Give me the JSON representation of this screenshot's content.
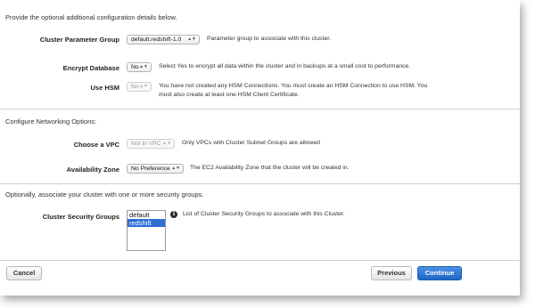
{
  "intro_text": "Provide the optional additional configuration details below.",
  "cluster_parameter_group": {
    "label": "Cluster Parameter Group",
    "value": "default.redshift-1.0",
    "help": "Parameter group to associate with this cluster."
  },
  "encrypt_database": {
    "label": "Encrypt Database",
    "value": "No",
    "help": "Select Yes to encrypt all data within the cluster and in backups at a small cost to performance."
  },
  "use_hsm": {
    "label": "Use HSM",
    "value": "No",
    "help_line1": "You have not created any HSM Connections. You must create an HSM Connection to use HSM. You",
    "help_line2": "must also create at least one HSM Client Certificate."
  },
  "networking_text": "Configure Networking Options:",
  "choose_vpc": {
    "label": "Choose a VPC",
    "value": "Not in VPC",
    "help": "Only VPCs with Cluster Subnet Groups are allowed"
  },
  "availability_zone": {
    "label": "Availability Zone",
    "value": "No Preference",
    "help": "The EC2 Availability Zone that the cluster will be created in."
  },
  "security_text": "Optionally, associate your cluster with one or more security groups.",
  "cluster_security_groups": {
    "label": "Cluster Security Groups",
    "options": [
      "default",
      "redshift"
    ],
    "selected": "redshift",
    "help": "List of Cluster Security Groups to associate with this Cluster."
  },
  "buttons": {
    "cancel": "Cancel",
    "previous": "Previous",
    "continue": "Continue"
  },
  "icons": {
    "caret": "chevron-updown-icon",
    "info": "info-icon"
  },
  "colors": {
    "primary_button": "#1f66c4",
    "selected_option": "#2d6ed5"
  }
}
